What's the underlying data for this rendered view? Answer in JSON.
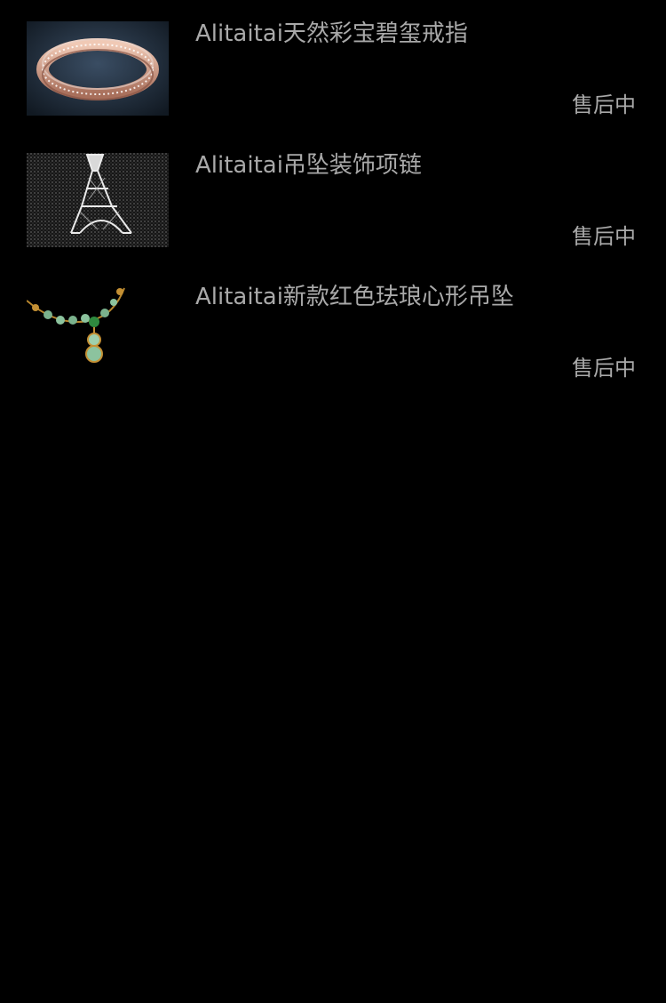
{
  "orders": [
    {
      "title": "Alitaitai天然彩宝碧玺戒指",
      "status": "售后中",
      "image": "rose-gold-diamond-ring"
    },
    {
      "title": "Alitaitai吊坠装饰项链",
      "status": "售后中",
      "image": "eiffel-tower-pendant"
    },
    {
      "title": "Alitaitai新款红色珐琅心形吊坠",
      "status": "售后中",
      "image": "emerald-bead-necklace"
    }
  ]
}
